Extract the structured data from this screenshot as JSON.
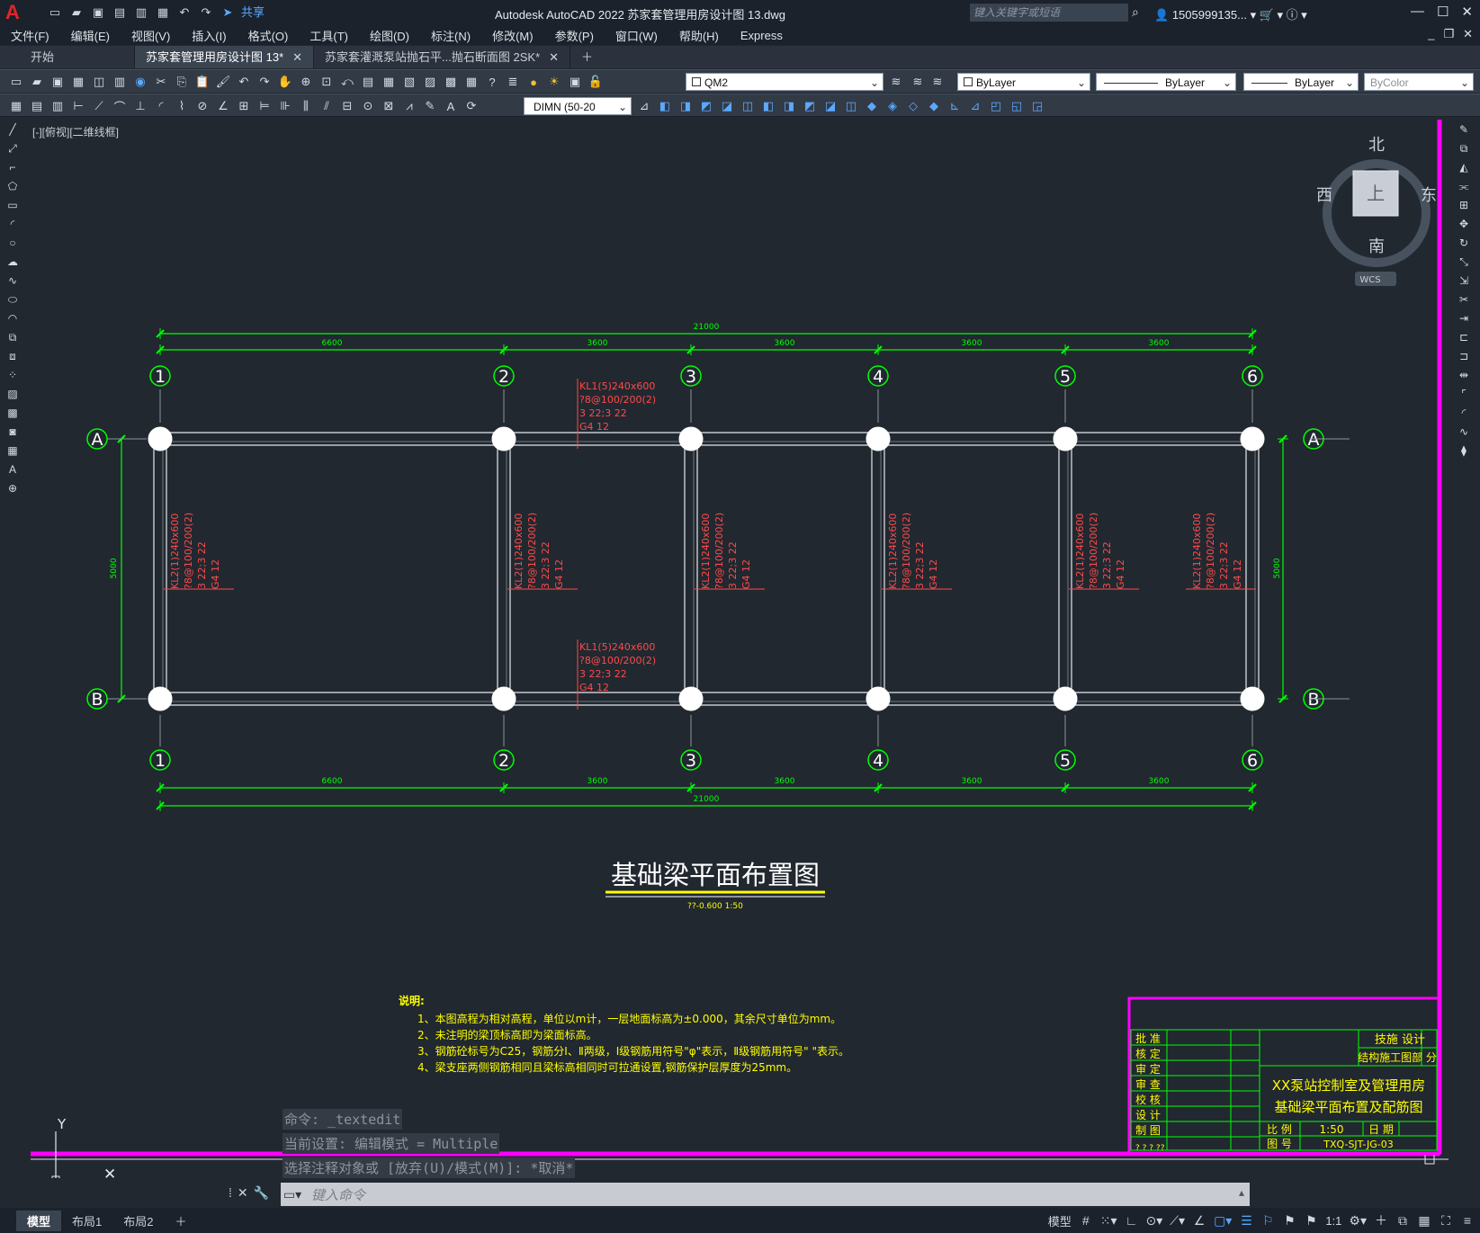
{
  "titlebar": {
    "app_title": "Autodesk AutoCAD 2022    苏家套管理用房设计图 13.dwg",
    "share": "共享",
    "search_placeholder": "键入关键字或短语",
    "user": "1505999135...",
    "icons": [
      "new-icon",
      "open-icon",
      "save-icon",
      "saveas-icon",
      "publish-icon",
      "plot-icon",
      "undo-icon",
      "redo-icon",
      "share-icon"
    ]
  },
  "menu": [
    "文件(F)",
    "编辑(E)",
    "视图(V)",
    "插入(I)",
    "格式(O)",
    "工具(T)",
    "绘图(D)",
    "标注(N)",
    "修改(M)",
    "参数(P)",
    "窗口(W)",
    "帮助(H)",
    "Express"
  ],
  "tabs": [
    {
      "label": "开始",
      "active": false,
      "closable": false
    },
    {
      "label": "苏家套管理用房设计图 13*",
      "active": true,
      "closable": true
    },
    {
      "label": "苏家套灌溉泵站抛石平...抛石断面图 2SK*",
      "active": false,
      "closable": true
    }
  ],
  "toolbar": {
    "layer": "QM2",
    "color": "ByLayer",
    "linetype": "ByLayer",
    "lineweight": "ByLayer",
    "plotstyle": "ByColor",
    "dimstyle": "DIMN (50-20"
  },
  "viewport_label": "[-][俯视][二维线框]",
  "viewcube": {
    "north": "北",
    "south": "南",
    "east": "东",
    "west": "西",
    "top": "上",
    "wcs": "WCS"
  },
  "drawing": {
    "dims_total": "21000",
    "dims_spans": [
      "6600",
      "3600",
      "3600",
      "3600",
      "3600"
    ],
    "dim_height": "5000",
    "axes_numbers": [
      "1",
      "2",
      "3",
      "4",
      "5",
      "6"
    ],
    "axes_letters": [
      "A",
      "B"
    ],
    "kl1_labels": [
      "KL1(5)240x600",
      "?8@100/200(2)",
      "3 22;3 22",
      "G4 12"
    ],
    "kl2_labels": [
      "KL2(1)240x600",
      "?8@100/200(2)",
      "3 22;3 22",
      "G4 12"
    ],
    "title": "基础梁平面布置图",
    "subtitle": "??-0.600  1:50",
    "notes_title": "说明:",
    "notes": [
      "1、本图高程为相对高程，单位以m计，一层地面标高为±0.000，其余尺寸单位为mm。",
      "2、未注明的梁顶标高即为梁面标高。",
      "3、钢筋砼标号为C25，钢筋分Ⅰ、Ⅱ两级，Ⅰ级钢筋用符号\"φ\"表示，Ⅱ级钢筋用符号\"  \"表示。",
      "4、梁支座两侧钢筋相同且梁标高相同时可拉通设置,钢筋保护层厚度为25mm。"
    ],
    "titleblock": {
      "rows": [
        "批 准",
        "核 定",
        "审 定",
        "审 查",
        "校 核",
        "设 计",
        "制 图"
      ],
      "org1": "技施 设计",
      "org2": "结构施工图部 分",
      "name1": "XX泵站控制室及管理用房",
      "name2": "基础梁平面布置及配筋图",
      "scale_label": "比 例",
      "scale": "1:50",
      "date_label": "日 期",
      "drawing_no_label": "图 号",
      "drawing_no": "TXQ-SJT-JG-03",
      "bottom": "? ? ? ??"
    }
  },
  "command": {
    "history": [
      "命令: _textedit",
      "当前设置: 编辑模式 = Multiple",
      "选择注释对象或 [放弃(U)/模式(M)]: *取消*"
    ],
    "placeholder": "键入命令"
  },
  "status": {
    "layouts": [
      "模型",
      "布局1",
      "布局2"
    ],
    "model_label": "模型",
    "scale": "1:1"
  },
  "colors": {
    "green": "#00ff00",
    "red": "#ff4a4a",
    "magenta": "#ff00ff",
    "yellow": "#ffff00",
    "white": "#ffffff",
    "bg": "#212830"
  }
}
